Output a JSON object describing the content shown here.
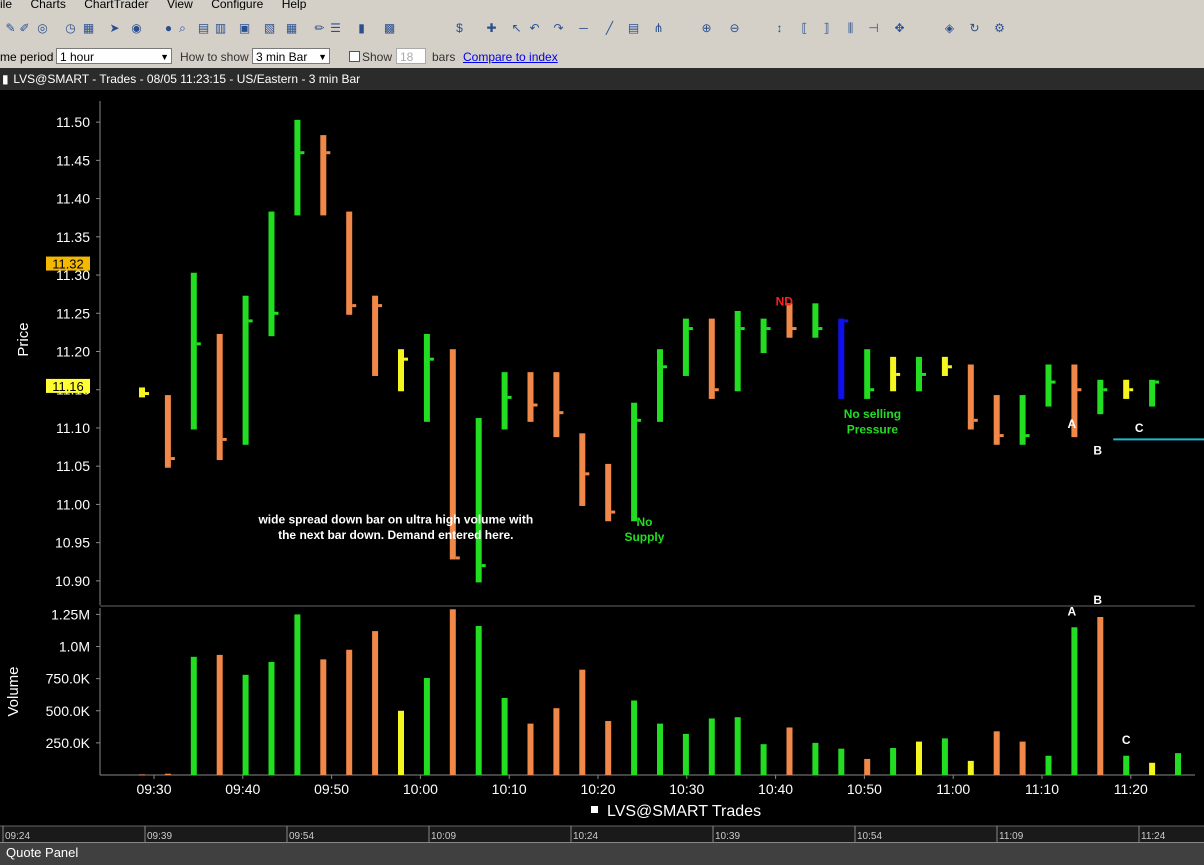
{
  "menu": [
    "ile",
    "Charts",
    "ChartTrader",
    "View",
    "Configure",
    "Help"
  ],
  "toolbar_icons": [
    "new-icon",
    "pencil-icon",
    "zoom-icon",
    "clock-icon",
    "grid-icon",
    "arrow-icon",
    "globe-icon",
    "sphere-icon",
    "magnify-icon",
    "chart-icon",
    "bar-icon",
    "image-icon",
    "pattern-icon",
    "table-icon",
    "draw-icon",
    "bars-icon",
    "candle-icon",
    "layout-icon",
    "dollar-icon",
    "crosshair-icon",
    "pointer-icon",
    "undo-icon",
    "redo-icon",
    "line-icon",
    "ray-icon",
    "fib-icon",
    "pitchfork-icon",
    "zoom-in-icon",
    "zoom-out-icon",
    "vert-icon",
    "bracket-icon",
    "bracket2-icon",
    "channel-icon",
    "split-icon",
    "scroll-icon",
    "color-icon",
    "refresh-icon",
    "settings-icon"
  ],
  "options": {
    "time_period_label": "me period",
    "time_period_value": "1 hour",
    "how_to_show_label": "How to show",
    "how_to_show_value": "3 min Bar",
    "show_label": "Show",
    "show_value": "18",
    "bars_label": "bars",
    "compare_link": "Compare to index"
  },
  "title": "LVS@SMART - Trades - 08/05 11:23:15 - US/Eastern - 3 min Bar",
  "status_bar": "Quote Panel",
  "colors": {
    "up": "#22dd22",
    "down": "#f0884a",
    "neutral": "#f5f520",
    "blue_bar": "#1010ee",
    "level_line": "#22b8c8",
    "current_price": "#ffff33",
    "price_marker": "#f5b800",
    "bg": "#000000"
  },
  "chart_data": {
    "type": "bar",
    "price_panel": {
      "ylabel": "Price",
      "ylim": [
        10.875,
        11.525
      ],
      "yticks": [
        "11.50",
        "11.45",
        "11.40",
        "11.35",
        "11.30",
        "11.25",
        "11.20",
        "11.15",
        "11.10",
        "11.05",
        "11.00",
        "10.95",
        "10.90"
      ],
      "price_markers": [
        {
          "label": "11.32",
          "value": 11.315,
          "color": "#f5b800"
        },
        {
          "label": "11.16",
          "value": 11.155,
          "color": "#ffff33"
        }
      ],
      "bars": [
        {
          "high": 11.153,
          "low": 11.14,
          "close": 11.145,
          "color": "yellow"
        },
        {
          "high": 11.143,
          "low": 11.048,
          "close": 11.06,
          "color": "orange"
        },
        {
          "high": 11.303,
          "low": 11.098,
          "close": 11.21,
          "color": "green"
        },
        {
          "high": 11.223,
          "low": 11.058,
          "close": 11.085,
          "color": "orange"
        },
        {
          "high": 11.273,
          "low": 11.078,
          "close": 11.24,
          "color": "green"
        },
        {
          "high": 11.383,
          "low": 11.22,
          "close": 11.25,
          "color": "green"
        },
        {
          "high": 11.503,
          "low": 11.378,
          "close": 11.46,
          "color": "green"
        },
        {
          "high": 11.483,
          "low": 11.378,
          "close": 11.46,
          "color": "orange"
        },
        {
          "high": 11.383,
          "low": 11.248,
          "close": 11.26,
          "color": "orange"
        },
        {
          "high": 11.273,
          "low": 11.168,
          "close": 11.26,
          "color": "orange"
        },
        {
          "high": 11.203,
          "low": 11.148,
          "close": 11.19,
          "color": "yellow"
        },
        {
          "high": 11.223,
          "low": 11.108,
          "close": 11.19,
          "color": "green"
        },
        {
          "high": 11.203,
          "low": 10.928,
          "close": 10.93,
          "color": "orange"
        },
        {
          "high": 11.113,
          "low": 10.898,
          "close": 10.92,
          "color": "green"
        },
        {
          "high": 11.173,
          "low": 11.098,
          "close": 11.14,
          "color": "green"
        },
        {
          "high": 11.173,
          "low": 11.108,
          "close": 11.13,
          "color": "orange"
        },
        {
          "high": 11.173,
          "low": 11.088,
          "close": 11.12,
          "color": "orange"
        },
        {
          "high": 11.093,
          "low": 10.998,
          "close": 11.04,
          "color": "orange"
        },
        {
          "high": 11.053,
          "low": 10.978,
          "close": 10.99,
          "color": "orange"
        },
        {
          "high": 11.133,
          "low": 10.978,
          "close": 11.11,
          "color": "green"
        },
        {
          "high": 11.203,
          "low": 11.108,
          "close": 11.18,
          "color": "green"
        },
        {
          "high": 11.243,
          "low": 11.168,
          "close": 11.23,
          "color": "green"
        },
        {
          "high": 11.243,
          "low": 11.138,
          "close": 11.15,
          "color": "orange"
        },
        {
          "high": 11.253,
          "low": 11.148,
          "close": 11.23,
          "color": "green"
        },
        {
          "high": 11.243,
          "low": 11.198,
          "close": 11.23,
          "color": "green"
        },
        {
          "high": 11.263,
          "low": 11.218,
          "close": 11.23,
          "color": "orange"
        },
        {
          "high": 11.263,
          "low": 11.218,
          "close": 11.23,
          "color": "green"
        },
        {
          "high": 11.243,
          "low": 11.138,
          "close": 11.24,
          "color": "blue"
        },
        {
          "high": 11.203,
          "low": 11.138,
          "close": 11.15,
          "color": "green"
        },
        {
          "high": 11.193,
          "low": 11.148,
          "close": 11.17,
          "color": "yellow"
        },
        {
          "high": 11.193,
          "low": 11.148,
          "close": 11.17,
          "color": "green"
        },
        {
          "high": 11.193,
          "low": 11.168,
          "close": 11.18,
          "color": "yellow"
        },
        {
          "high": 11.183,
          "low": 11.098,
          "close": 11.11,
          "color": "orange"
        },
        {
          "high": 11.143,
          "low": 11.078,
          "close": 11.09,
          "color": "orange"
        },
        {
          "high": 11.143,
          "low": 11.078,
          "close": 11.09,
          "color": "green"
        },
        {
          "high": 11.183,
          "low": 11.128,
          "close": 11.16,
          "color": "green"
        },
        {
          "high": 11.183,
          "low": 11.088,
          "close": 11.15,
          "color": "orange"
        },
        {
          "high": 11.163,
          "low": 11.118,
          "close": 11.15,
          "color": "green"
        },
        {
          "high": 11.163,
          "low": 11.138,
          "close": 11.15,
          "color": "yellow"
        },
        {
          "high": 11.163,
          "low": 11.128,
          "close": 11.16,
          "color": "green"
        }
      ],
      "support_line": {
        "value": 11.085,
        "from_bar": 37.5,
        "to_bar": 41.4
      },
      "annotations": [
        {
          "text": "wide spread down bar on ultra high volume with",
          "bar": 9.8,
          "value": 10.975,
          "color": "#ffffff"
        },
        {
          "text": "the next bar down. Demand entered here.",
          "bar": 9.8,
          "value": 10.955,
          "color": "#ffffff"
        },
        {
          "text": "No",
          "bar": 19.4,
          "value": 10.972,
          "color": "#22dd22"
        },
        {
          "text": "Supply",
          "bar": 19.4,
          "value": 10.952,
          "color": "#22dd22"
        },
        {
          "text": "ND",
          "bar": 24.8,
          "value": 11.26,
          "color": "#ff2020"
        },
        {
          "text": "No selling",
          "bar": 28.2,
          "value": 11.113,
          "color": "#22dd22"
        },
        {
          "text": "Pressure",
          "bar": 28.2,
          "value": 11.093,
          "color": "#22dd22"
        },
        {
          "text": "A",
          "bar": 35.9,
          "value": 11.1,
          "color": "#ffffff"
        },
        {
          "text": "B",
          "bar": 36.9,
          "value": 11.065,
          "color": "#ffffff"
        },
        {
          "text": "C",
          "bar": 38.5,
          "value": 11.095,
          "color": "#ffffff"
        }
      ]
    },
    "volume_panel": {
      "ylabel": "Volume",
      "ylim": [
        0,
        1300000
      ],
      "yticks": [
        {
          "label": "1.25M",
          "value": 1250000
        },
        {
          "label": "1.0M",
          "value": 1000000
        },
        {
          "label": "750.0K",
          "value": 750000
        },
        {
          "label": "500.0K",
          "value": 500000
        },
        {
          "label": "250.0K",
          "value": 250000
        }
      ],
      "values": [
        5000,
        10000,
        920000,
        935000,
        780000,
        880000,
        1250000,
        900000,
        975000,
        1120000,
        500000,
        755000,
        1290000,
        1160000,
        600000,
        400000,
        520000,
        820000,
        420000,
        580000,
        400000,
        320000,
        440000,
        450000,
        240000,
        370000,
        250000,
        205000,
        125000,
        210000,
        260000,
        285000,
        110000,
        340000,
        260000,
        150000,
        1150000,
        1230000,
        150000,
        95000,
        170000
      ],
      "colors": [
        "orange",
        "orange",
        "green",
        "orange",
        "green",
        "green",
        "green",
        "orange",
        "orange",
        "orange",
        "yellow",
        "green",
        "orange",
        "green",
        "green",
        "orange",
        "orange",
        "orange",
        "orange",
        "green",
        "green",
        "green",
        "green",
        "green",
        "green",
        "orange",
        "green",
        "green",
        "orange",
        "green",
        "yellow",
        "green",
        "yellow",
        "orange",
        "orange",
        "green",
        "green",
        "orange",
        "green",
        "yellow",
        "green"
      ],
      "annotations": [
        {
          "text": "A",
          "bar": 35.9,
          "value": 1240000
        },
        {
          "text": "B",
          "bar": 36.9,
          "value": 1330000
        },
        {
          "text": "C",
          "bar": 38.0,
          "value": 240000
        }
      ]
    },
    "xticks": [
      "09:30",
      "09:40",
      "09:50",
      "10:00",
      "10:10",
      "10:20",
      "10:30",
      "10:40",
      "10:50",
      "11:00",
      "11:10",
      "11:20"
    ],
    "legend": "LVS@SMART Trades",
    "timeline_labels": [
      "09:24",
      "09:39",
      "09:54",
      "10:09",
      "10:24",
      "10:39",
      "10:54",
      "11:09",
      "11:24"
    ]
  }
}
